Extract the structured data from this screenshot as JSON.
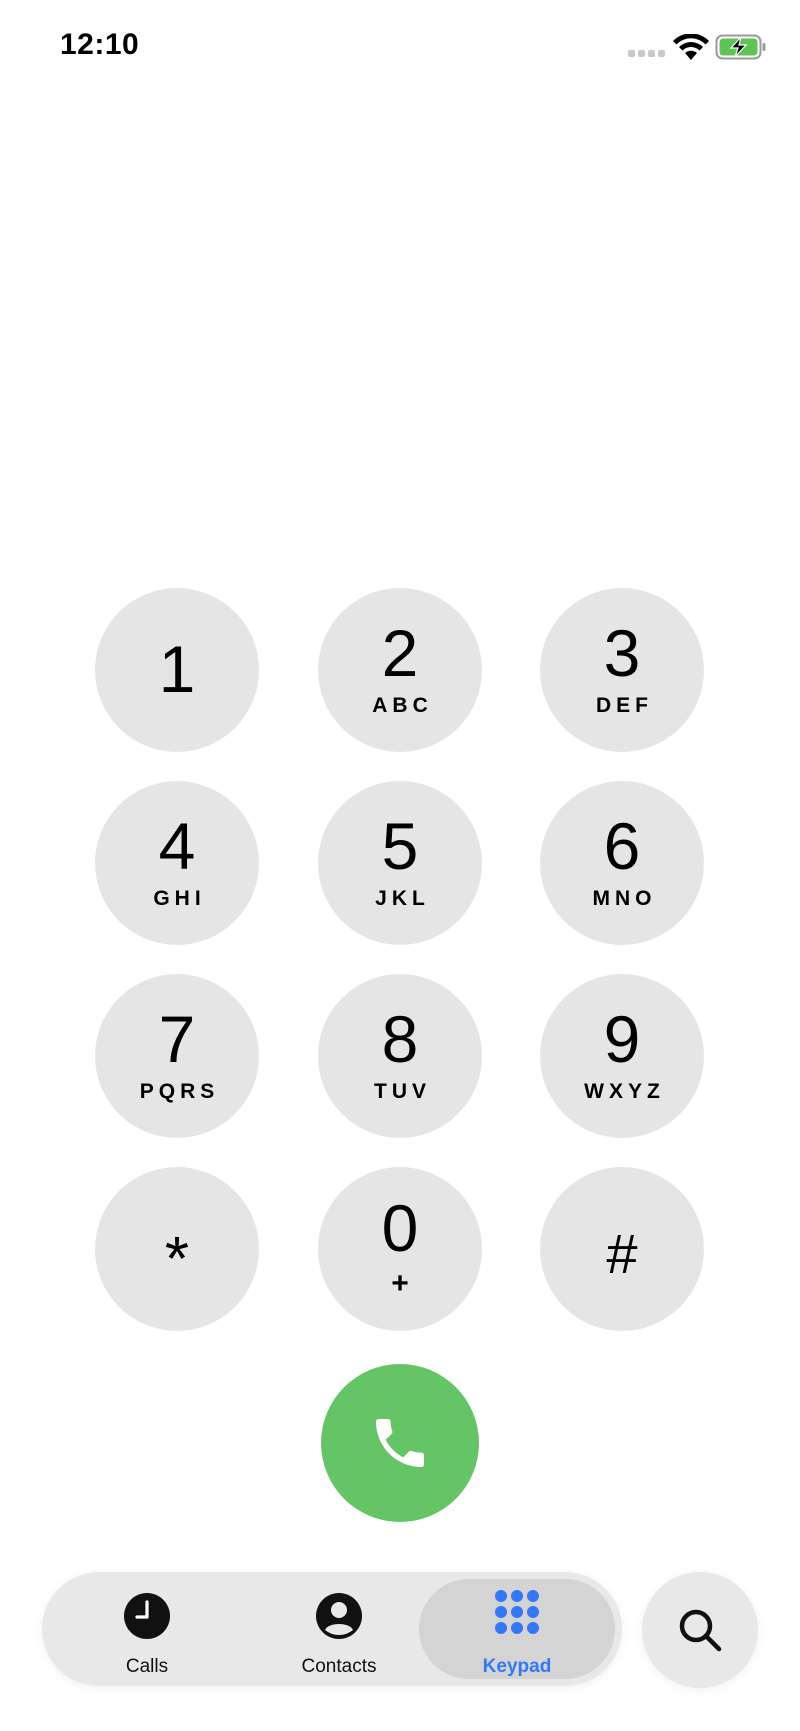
{
  "status_bar": {
    "time": "12:10",
    "icons": [
      "signal-icon",
      "wifi-icon",
      "battery-charging-icon"
    ]
  },
  "keypad": {
    "keys": [
      {
        "digit": "1",
        "letters": ""
      },
      {
        "digit": "2",
        "letters": "ABC"
      },
      {
        "digit": "3",
        "letters": "DEF"
      },
      {
        "digit": "4",
        "letters": "GHI"
      },
      {
        "digit": "5",
        "letters": "JKL"
      },
      {
        "digit": "6",
        "letters": "MNO"
      },
      {
        "digit": "7",
        "letters": "PQRS"
      },
      {
        "digit": "8",
        "letters": "TUV"
      },
      {
        "digit": "9",
        "letters": "WXYZ"
      },
      {
        "digit": "*",
        "letters": ""
      },
      {
        "digit": "0",
        "letters": "+"
      },
      {
        "digit": "#",
        "letters": ""
      }
    ]
  },
  "call_button": {
    "icon": "phone-icon",
    "color": "#65c466"
  },
  "tab_bar": {
    "tabs": [
      {
        "label": "Calls",
        "icon": "clock-icon"
      },
      {
        "label": "Contacts",
        "icon": "person-circle-icon"
      },
      {
        "label": "Keypad",
        "icon": "keypad-grid-icon",
        "active": true
      }
    ],
    "search_icon": "search-icon",
    "accent_color": "#3478f6"
  }
}
